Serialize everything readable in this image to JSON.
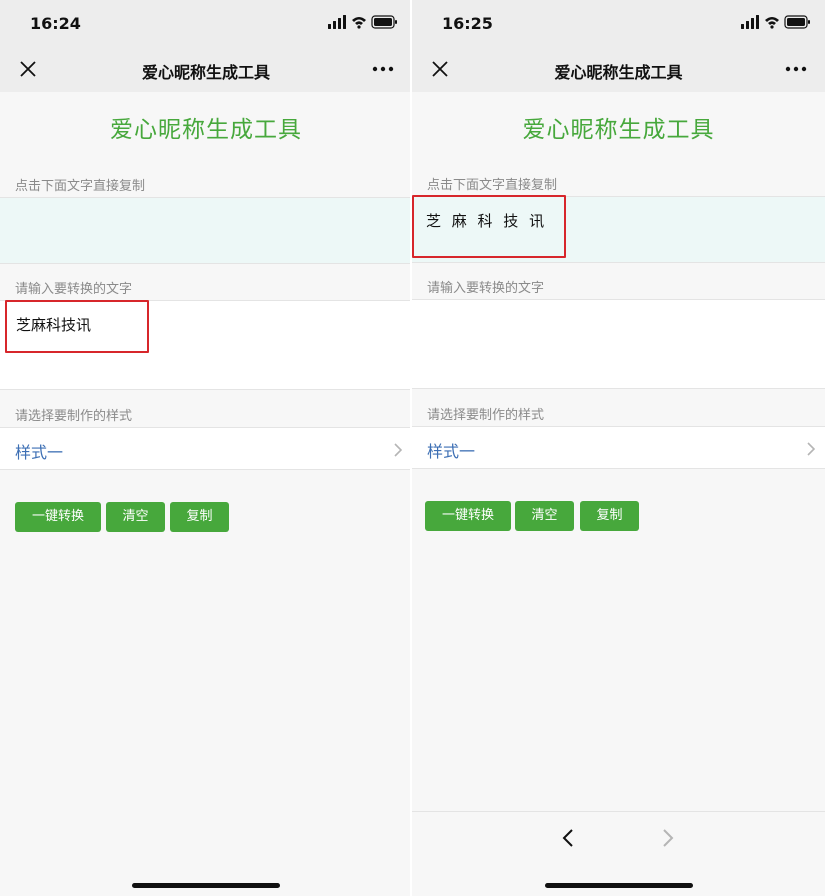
{
  "colors": {
    "accent": "#47a83c",
    "highlight": "#d7262b",
    "link": "#3d6fb4"
  },
  "left": {
    "status": {
      "time": "16:24"
    },
    "nav": {
      "title": "爱心昵称生成工具",
      "close_icon": "close-icon",
      "more_icon": "more-icon"
    },
    "heading": "爱心昵称生成工具",
    "output_label": "点击下面文字直接复制",
    "output_text": "",
    "input_label": "请输入要转换的文字",
    "input_value": "芝麻科技讯",
    "style_label": "请选择要制作的样式",
    "style_value": "样式一",
    "buttons": {
      "convert": "一键转换",
      "clear": "清空",
      "copy": "复制"
    }
  },
  "right": {
    "status": {
      "time": "16:25"
    },
    "nav": {
      "title": "爱心昵称生成工具",
      "close_icon": "close-icon",
      "more_icon": "more-icon"
    },
    "heading": "爱心昵称生成工具",
    "output_label": "点击下面文字直接复制",
    "output_text": "芝 麻 科 技 讯",
    "input_label": "请输入要转换的文字",
    "input_value": "",
    "style_label": "请选择要制作的样式",
    "style_value": "样式一",
    "buttons": {
      "convert": "一键转换",
      "clear": "清空",
      "copy": "复制"
    },
    "toolbar": {
      "back_icon": "chevron-left-icon",
      "forward_icon": "chevron-right-icon"
    }
  }
}
